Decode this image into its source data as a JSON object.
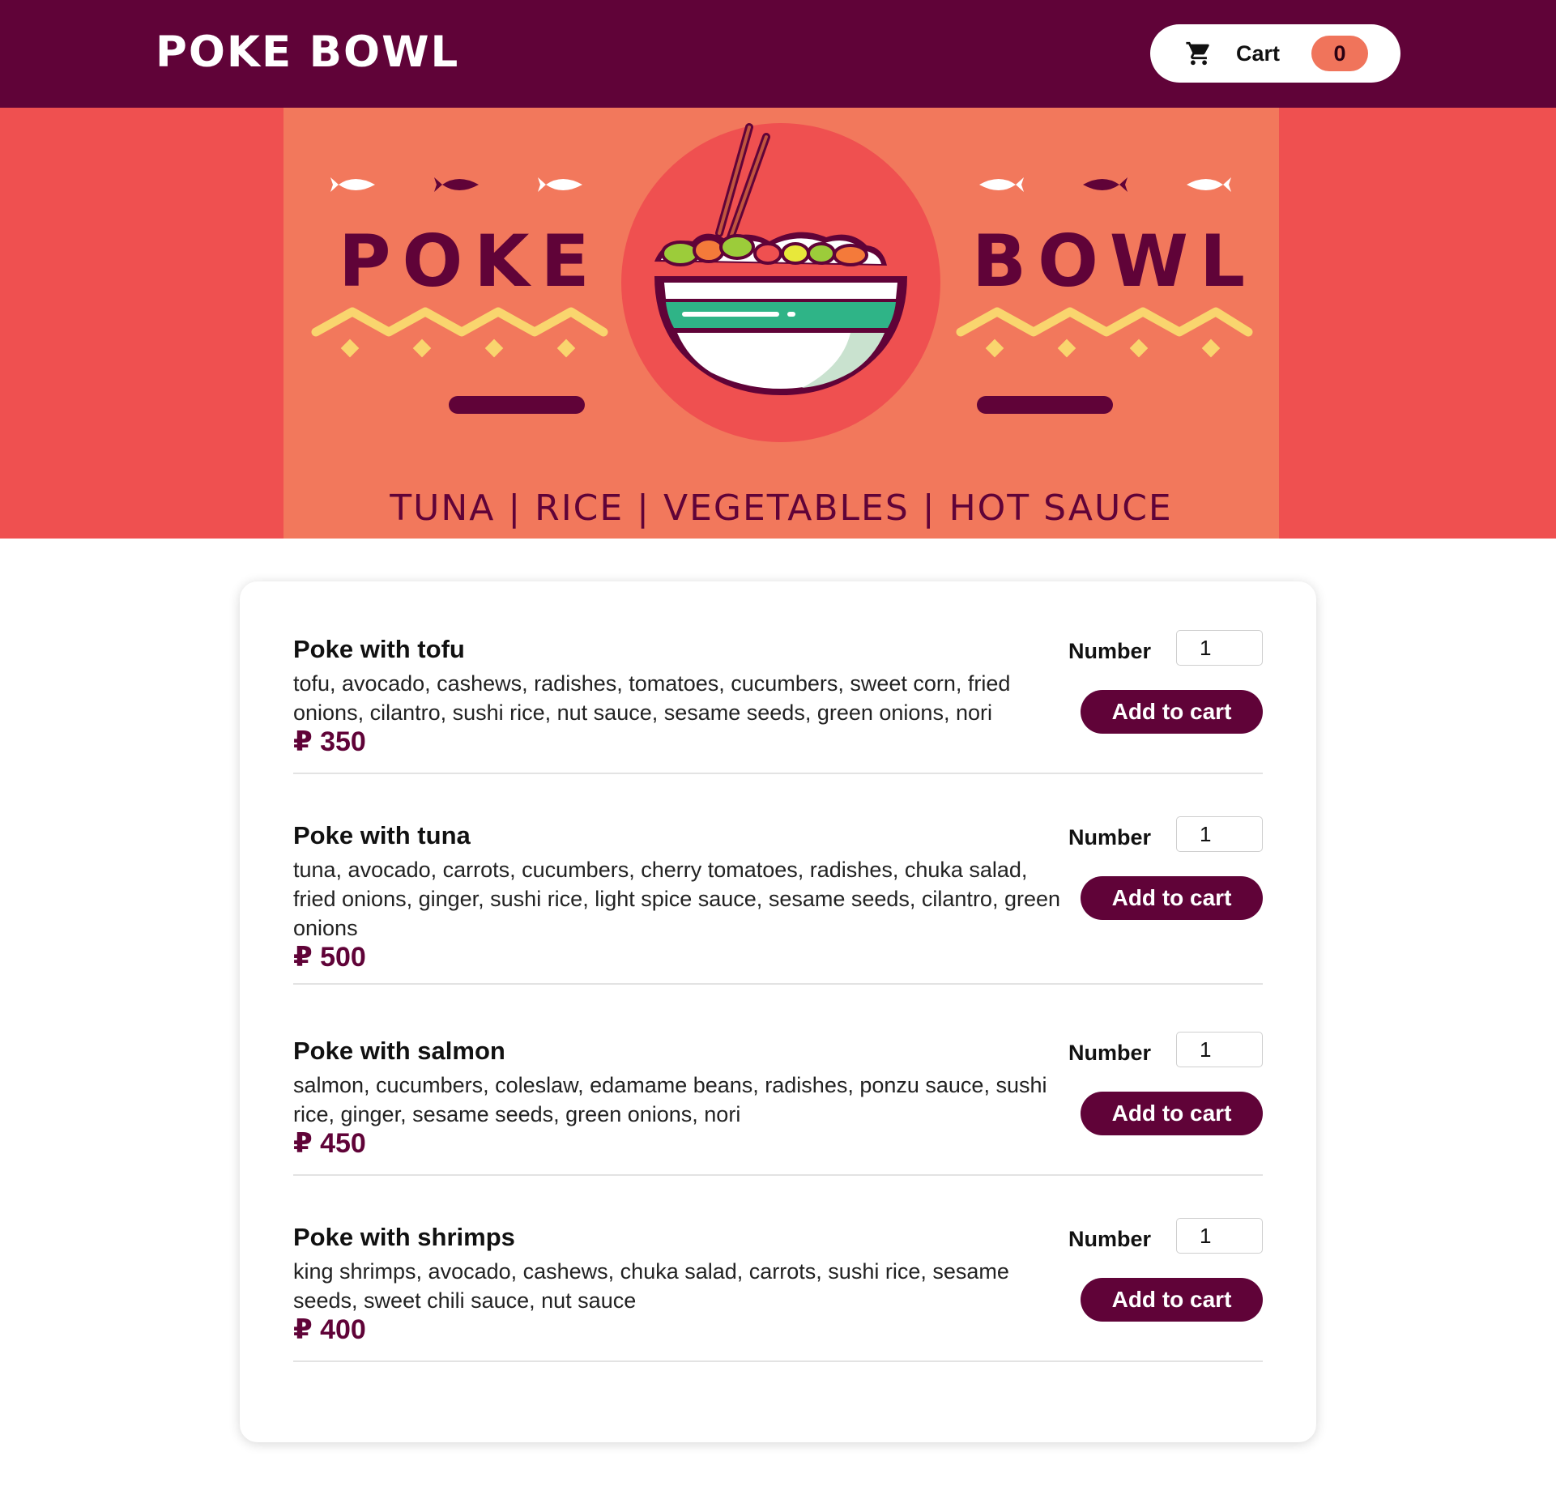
{
  "header": {
    "logo": "POKE BOWL",
    "cart_label": "Cart",
    "cart_count": "0",
    "cart_icon": "shopping-cart-icon"
  },
  "banner": {
    "word_left": "POKE",
    "word_right": "BOWL",
    "tagline": "TUNA | RICE | VEGETABLES | HOT SAUCE",
    "illustration": "poke-bowl-illustration"
  },
  "menu": {
    "quantity_label": "Number",
    "add_label": "Add to cart",
    "items": [
      {
        "title": "Poke with tofu",
        "description": "tofu, avocado, cashews, radishes, tomatoes, cucumbers, sweet corn, fried onions, cilantro, sushi rice, nut sauce, sesame seeds, green onions, nori",
        "price": "₽ 350",
        "quantity": "1"
      },
      {
        "title": "Poke with tuna",
        "description": "tuna, avocado, carrots, cucumbers, cherry tomatoes, radishes, chuka salad, fried onions, ginger, sushi rice, light spice sauce, sesame seeds, cilantro, green onions",
        "price": "₽ 500",
        "quantity": "1"
      },
      {
        "title": "Poke with salmon",
        "description": "salmon, cucumbers, coleslaw, edamame beans, radishes, ponzu sauce, sushi rice, ginger, sesame seeds, green onions, nori",
        "price": "₽ 450",
        "quantity": "1"
      },
      {
        "title": "Poke with shrimps",
        "description": "king shrimps, avocado, cashews, chuka salad, carrots, sushi rice, sesame seeds, sweet chili sauce, nut sauce",
        "price": "₽ 400",
        "quantity": "1"
      }
    ]
  },
  "colors": {
    "brand": "#600338",
    "accent": "#f2785c",
    "banner_bg": "#ef5050",
    "zigzag": "#f9d56e"
  }
}
